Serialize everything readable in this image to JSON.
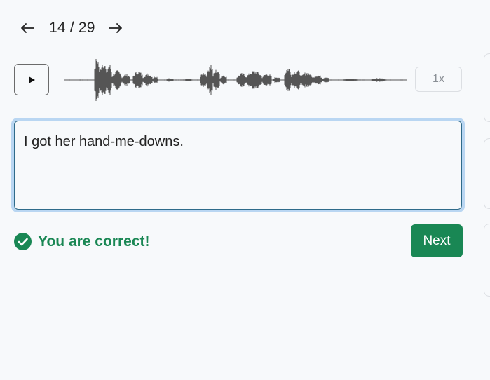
{
  "pager": {
    "text": "14 / 29",
    "prev_icon": "arrow-left-icon",
    "next_icon": "arrow-right-icon"
  },
  "audio": {
    "play_icon": "play-icon",
    "speed_label": "1x",
    "waveform_color": "#555555"
  },
  "answer": {
    "value": "I got her hand-me-downs."
  },
  "feedback": {
    "icon": "check-circle-icon",
    "text": "You are correct!",
    "color": "#1a8754"
  },
  "next_button": {
    "label": "Next",
    "color": "#198754"
  }
}
